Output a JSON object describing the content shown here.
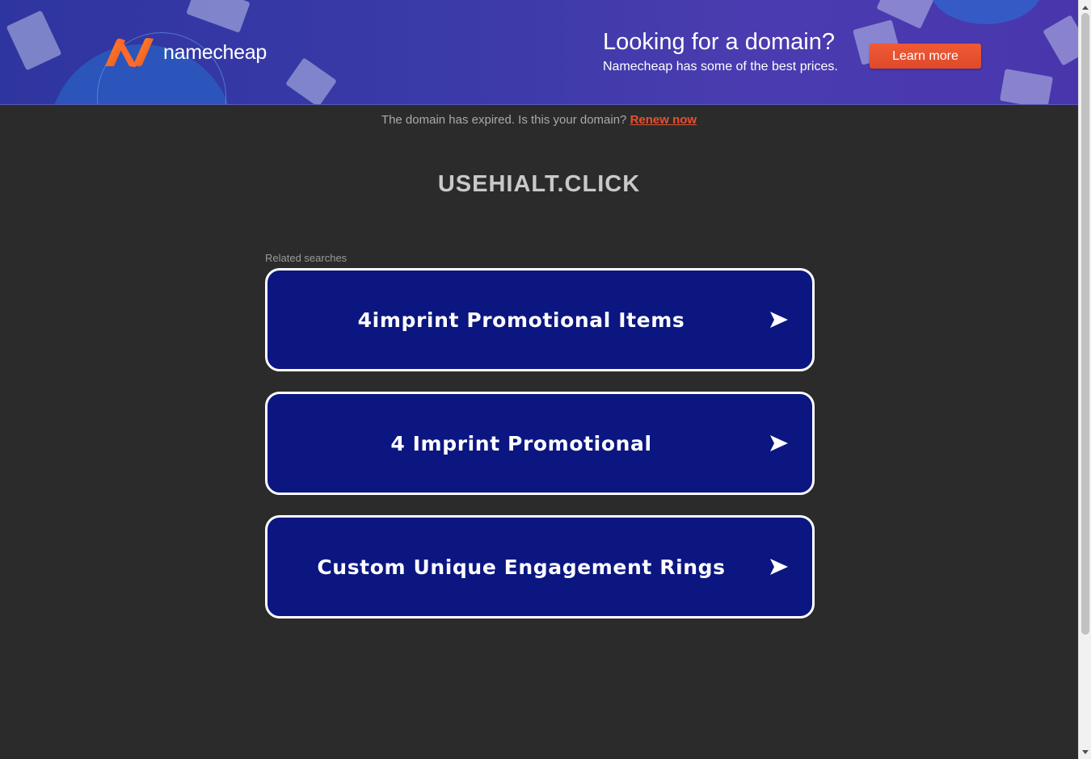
{
  "banner": {
    "brand": "namecheap",
    "promo_title": "Looking for a domain?",
    "promo_subtitle": "Namecheap has some of the best prices.",
    "cta_label": "Learn more"
  },
  "notice": {
    "text": "The domain has expired. Is this your domain? ",
    "link_label": "Renew now"
  },
  "domain": "USEHIALT.CLICK",
  "related": {
    "label": "Related searches",
    "items": [
      {
        "label": "4imprint Promotional Items"
      },
      {
        "label": "4 Imprint Promotional"
      },
      {
        "label": "Custom Unique Engagement Rings"
      }
    ]
  },
  "colors": {
    "background": "#2b2b2b",
    "banner": "#3a3aa8",
    "accent": "#e8502f",
    "card": "#0b1681"
  },
  "icons": {
    "logo": "namecheap-logo-icon",
    "arrow": "arrow-right-icon"
  }
}
